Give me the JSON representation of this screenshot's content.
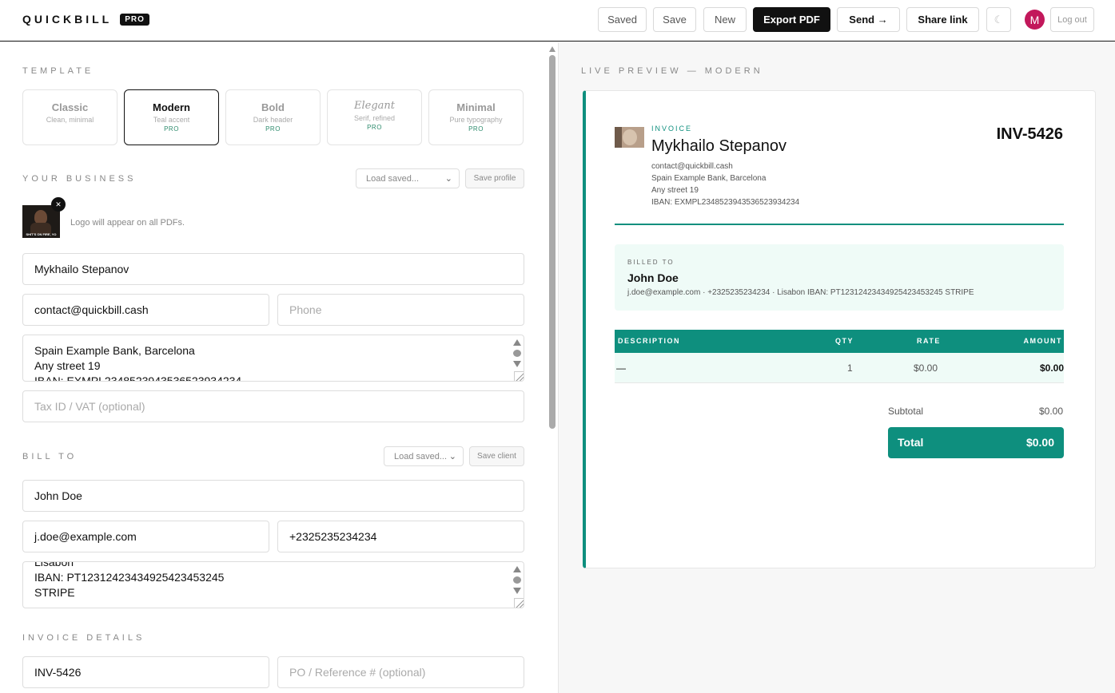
{
  "brand": {
    "name": "QUICKBILL",
    "badge": "PRO"
  },
  "toolbar": {
    "saved": "Saved",
    "save": "Save",
    "new": "New",
    "export_pdf": "Export PDF",
    "send": "Send →",
    "share_link": "Share link",
    "theme_icon": "☾",
    "avatar_initial": "M",
    "logout": "Log out"
  },
  "template": {
    "label": "TEMPLATE",
    "options": [
      {
        "name": "Classic",
        "sub": "Clean, minimal",
        "pro": ""
      },
      {
        "name": "Modern",
        "sub": "Teal accent",
        "pro": "PRO"
      },
      {
        "name": "Bold",
        "sub": "Dark header",
        "pro": "PRO"
      },
      {
        "name": "Elegant",
        "sub": "Serif, refined",
        "pro": "PRO"
      },
      {
        "name": "Minimal",
        "sub": "Pure typography",
        "pro": "PRO"
      }
    ],
    "selected": "Modern"
  },
  "business": {
    "label": "YOUR BUSINESS",
    "load_saved": "Load saved...",
    "save_profile": "Save profile",
    "logo_note": "Logo will appear on all PDFs.",
    "logo_caption": "SHIT'S ON FIRE, YO",
    "name": "Mykhailo Stepanov",
    "email": "contact@quickbill.cash",
    "phone_placeholder": "Phone",
    "address_lines": [
      "Spain Example Bank, Barcelona",
      "Any street 19",
      "IBAN: EXMPL2348523943536523934234"
    ],
    "tax_placeholder": "Tax ID / VAT (optional)"
  },
  "bill_to": {
    "label": "BILL TO",
    "load_saved": "Load saved...",
    "save_client": "Save client",
    "name": "John Doe",
    "email": "j.doe@example.com",
    "phone": "+2325235234234",
    "address_lines": [
      "Lisabon",
      "IBAN: PT12312423434925423453245",
      "STRIPE"
    ]
  },
  "invoice_details": {
    "label": "INVOICE DETAILS",
    "number": "INV-5426",
    "po_placeholder": "PO / Reference # (optional)"
  },
  "preview": {
    "label": "LIVE PREVIEW — MODERN",
    "kicker": "INVOICE",
    "from_name": "Mykhailo Stepanov",
    "from_lines": [
      "contact@quickbill.cash",
      "Spain Example Bank, Barcelona",
      "Any street 19",
      "IBAN: EXMPL2348523943536523934234"
    ],
    "number": "INV-5426",
    "billed_to_label": "BILLED TO",
    "billed_to_name": "John Doe",
    "billed_to_detail": "j.doe@example.com · +2325235234234 · Lisabon IBAN: PT12312423434925423453245 STRIPE",
    "columns": [
      "DESCRIPTION",
      "QTY",
      "RATE",
      "AMOUNT"
    ],
    "rows": [
      {
        "description": "—",
        "qty": "1",
        "rate": "$0.00",
        "amount": "$0.00"
      }
    ],
    "subtotal_label": "Subtotal",
    "subtotal_value": "$0.00",
    "total_label": "Total",
    "total_value": "$0.00"
  },
  "colors": {
    "accent": "#0e8f7e",
    "accent_light": "#effbf7",
    "avatar": "#c2185b",
    "dark": "#111111"
  }
}
